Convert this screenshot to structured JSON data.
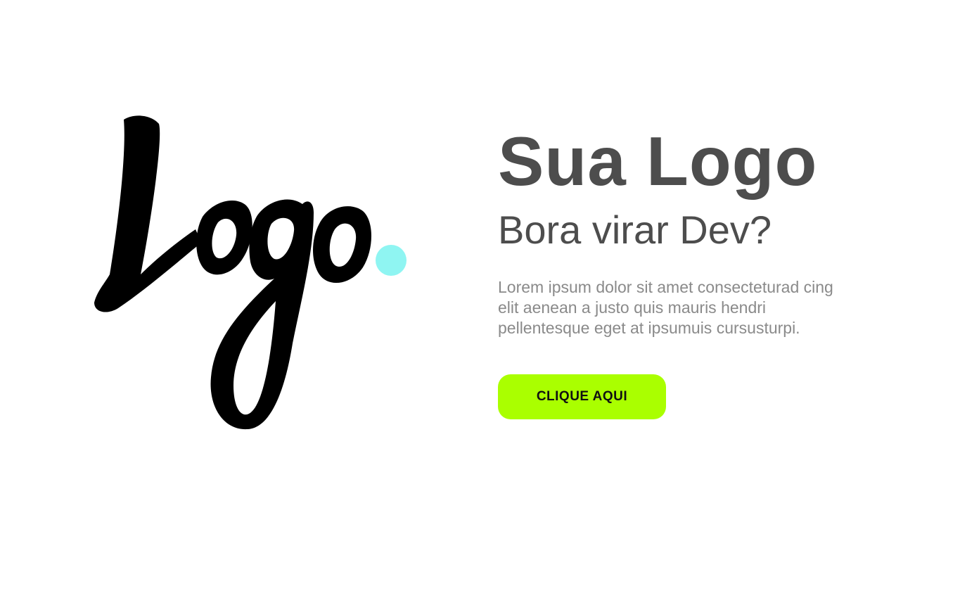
{
  "logo": {
    "wordmark": "Logo",
    "icon": "logo-script-mark",
    "dot_color": "#8ff5f2",
    "ink_color": "#000000"
  },
  "hero": {
    "title": "Sua Logo",
    "subtitle": "Bora virar Dev?",
    "paragraph": "Lorem ipsum dolor sit amet consecteturad cing elit aenean a justo quis mauris hendri pellentesque eget at ipsumuis cursusturpi.",
    "text_color": "#4d4d4d",
    "paragraph_color": "#8a8a8a"
  },
  "cta": {
    "label": "CLIQUE AQUI",
    "background": "#aaff00"
  }
}
